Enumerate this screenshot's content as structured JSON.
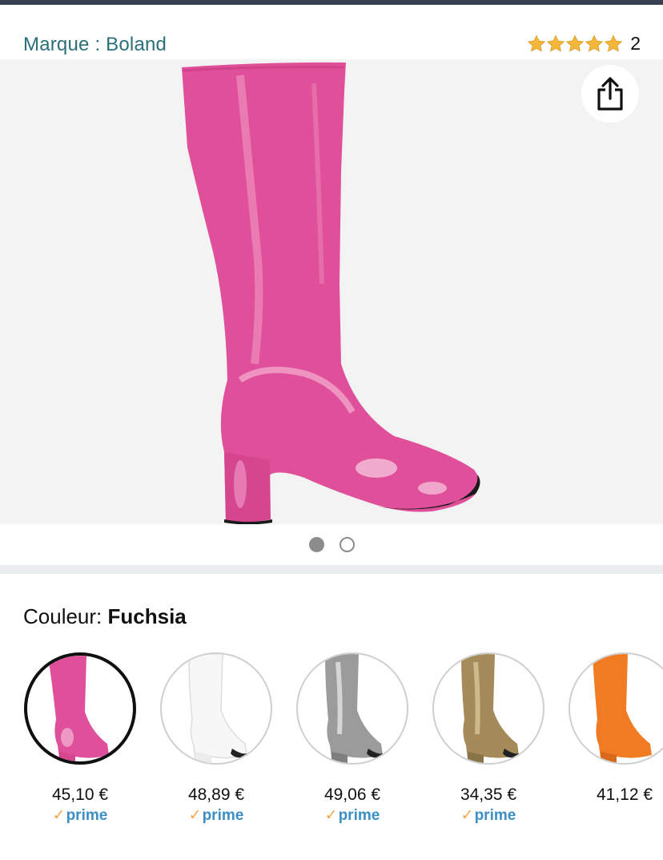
{
  "header": {
    "brand_link": "Marque : Boland",
    "rating_value": 5,
    "rating_count": "2",
    "star_color": "#f4b73b"
  },
  "gallery": {
    "share_icon": "share-icon",
    "pages": 2,
    "current_page": 1,
    "main_color": "#e0509a"
  },
  "variations": {
    "label_prefix": "Couleur:",
    "selected_color": "Fuchsia",
    "options": [
      {
        "color_hex": "#e0509a",
        "price": "45,10 €",
        "prime": "prime",
        "selected": true
      },
      {
        "color_hex": "#f7f7f7",
        "price": "48,89 €",
        "prime": "prime",
        "selected": false
      },
      {
        "color_hex": "#9b9b9b",
        "price": "49,06 €",
        "prime": "prime",
        "selected": false
      },
      {
        "color_hex": "#a58a5a",
        "price": "34,35 €",
        "prime": "prime",
        "selected": false
      },
      {
        "color_hex": "#f07b22",
        "price": "41,12 €",
        "prime": "",
        "selected": false
      }
    ]
  }
}
